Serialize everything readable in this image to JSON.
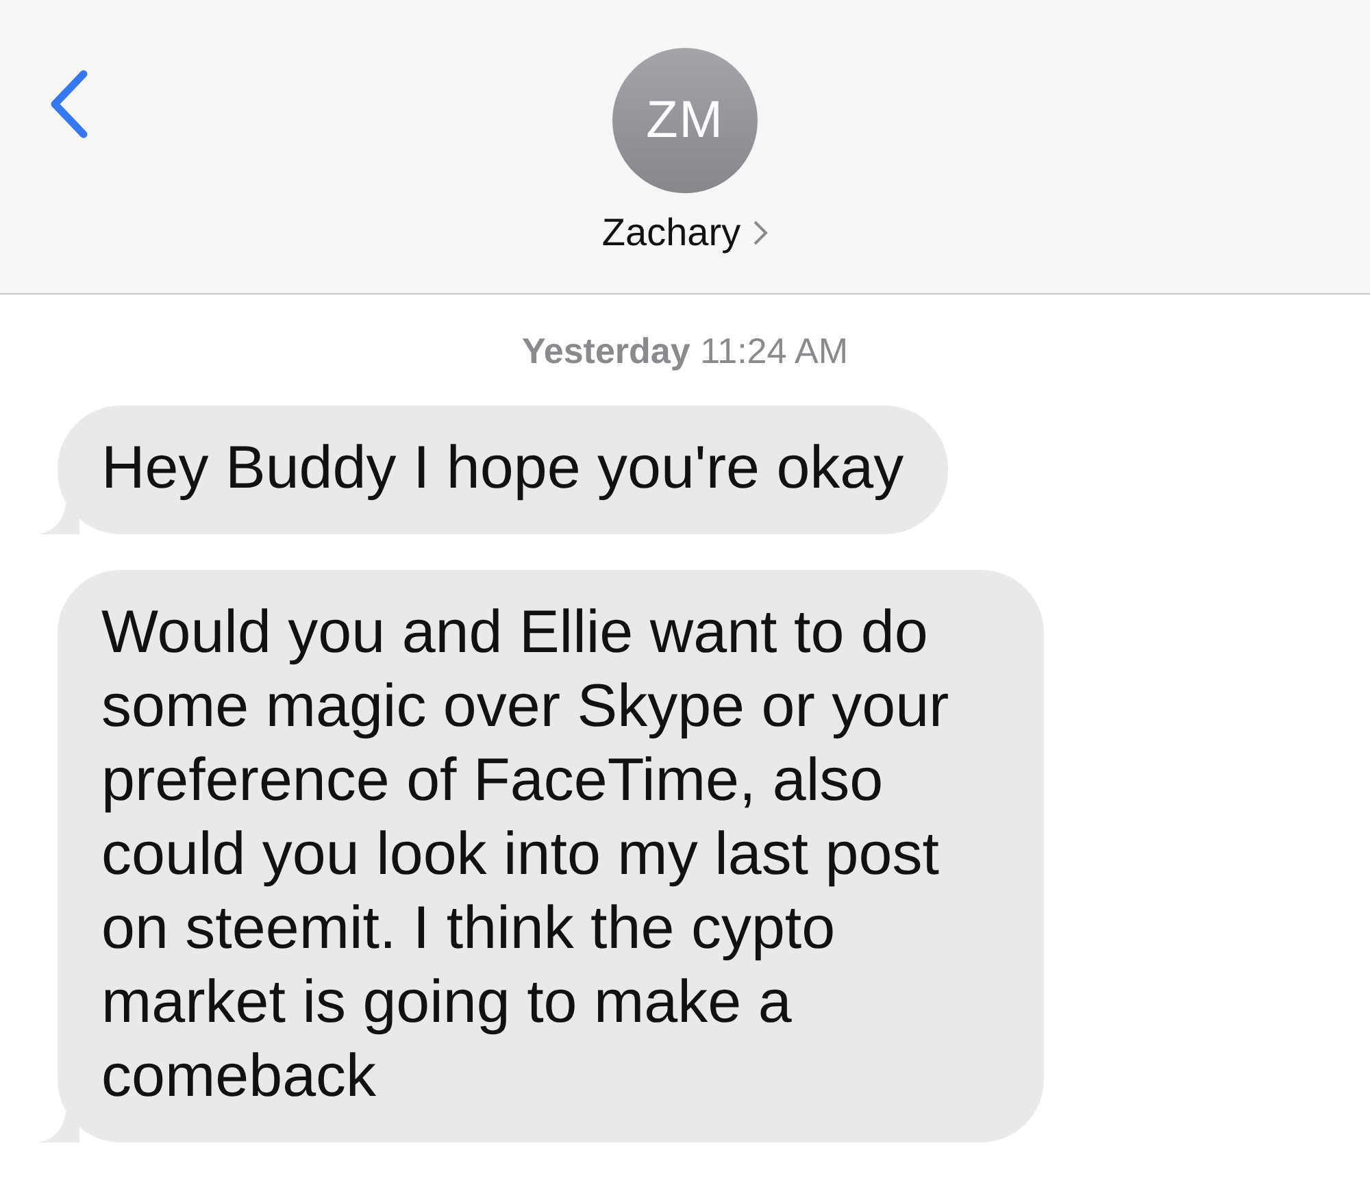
{
  "header": {
    "avatar_initials": "ZM",
    "contact_name": "Zachary"
  },
  "timestamp": {
    "day": "Yesterday",
    "time": "11:24 AM"
  },
  "messages": [
    {
      "text": "Hey Buddy I hope you're okay"
    },
    {
      "text": "Would you and Ellie want to do some magic over Skype or your preference of FaceTime, also could you look into my last post on steemit. I think the cypto market is going to make a comeback"
    }
  ]
}
